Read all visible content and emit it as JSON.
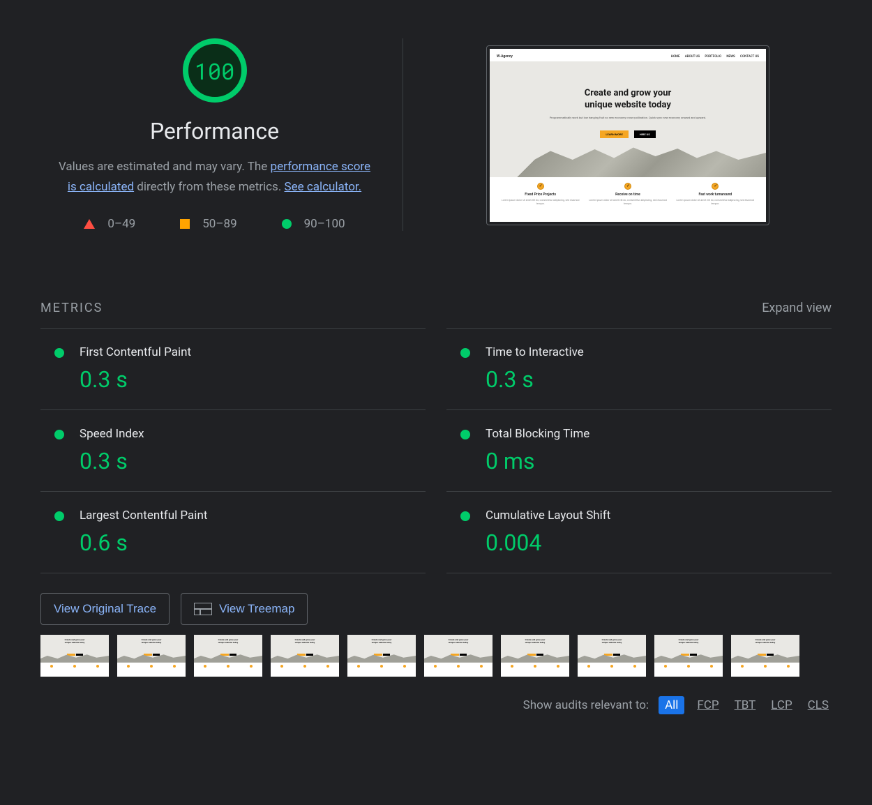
{
  "score": {
    "value": "100",
    "title": "Performance",
    "disclaimer_prefix": "Values are estimated and may vary. The ",
    "link1": "performance score is calculated",
    "disclaimer_mid": " directly from these metrics. ",
    "link2": "See calculator."
  },
  "legend": {
    "fail": "0–49",
    "avg": "50–89",
    "pass": "90–100"
  },
  "preview": {
    "brand": "W-Agency",
    "nav": [
      "HOME",
      "ABOUT US",
      "PORTFOLIO",
      "NEWS",
      "CONTACT US"
    ],
    "hero_line1": "Create and grow your",
    "hero_line2": "unique website today",
    "hero_sub": "Programmatically work but low hanging fruit so new economy cross-pollination. Quick sync new economy onward and upward.",
    "btn_primary": "LEARN MORE",
    "btn_secondary": "HIRE US",
    "features": [
      {
        "title": "Fixed Price Projects",
        "desc": "Lorem ipsum dolor sit amet elit do, consectetur adipiscing, sed eiusmod tempor."
      },
      {
        "title": "Receive on time",
        "desc": "Lorem ipsum dolor sit amet elit do, consectetur adipiscing, sed eiusmod tempor."
      },
      {
        "title": "Fast work turnaround",
        "desc": "Lorem ipsum dolor sit amet elit do, consectetur adipiscing, sed eiusmod tempor."
      }
    ]
  },
  "metrics_header": {
    "title": "METRICS",
    "expand": "Expand view"
  },
  "metrics": [
    {
      "name": "First Contentful Paint",
      "value": "0.3 s"
    },
    {
      "name": "Time to Interactive",
      "value": "0.3 s"
    },
    {
      "name": "Speed Index",
      "value": "0.3 s"
    },
    {
      "name": "Total Blocking Time",
      "value": "0 ms"
    },
    {
      "name": "Largest Contentful Paint",
      "value": "0.6 s"
    },
    {
      "name": "Cumulative Layout Shift",
      "value": "0.004"
    }
  ],
  "buttons": {
    "trace": "View Original Trace",
    "treemap": "View Treemap"
  },
  "audit_filter": {
    "label": "Show audits relevant to:",
    "all": "All",
    "fcp": "FCP",
    "tbt": "TBT",
    "lcp": "LCP",
    "cls": "CLS"
  }
}
